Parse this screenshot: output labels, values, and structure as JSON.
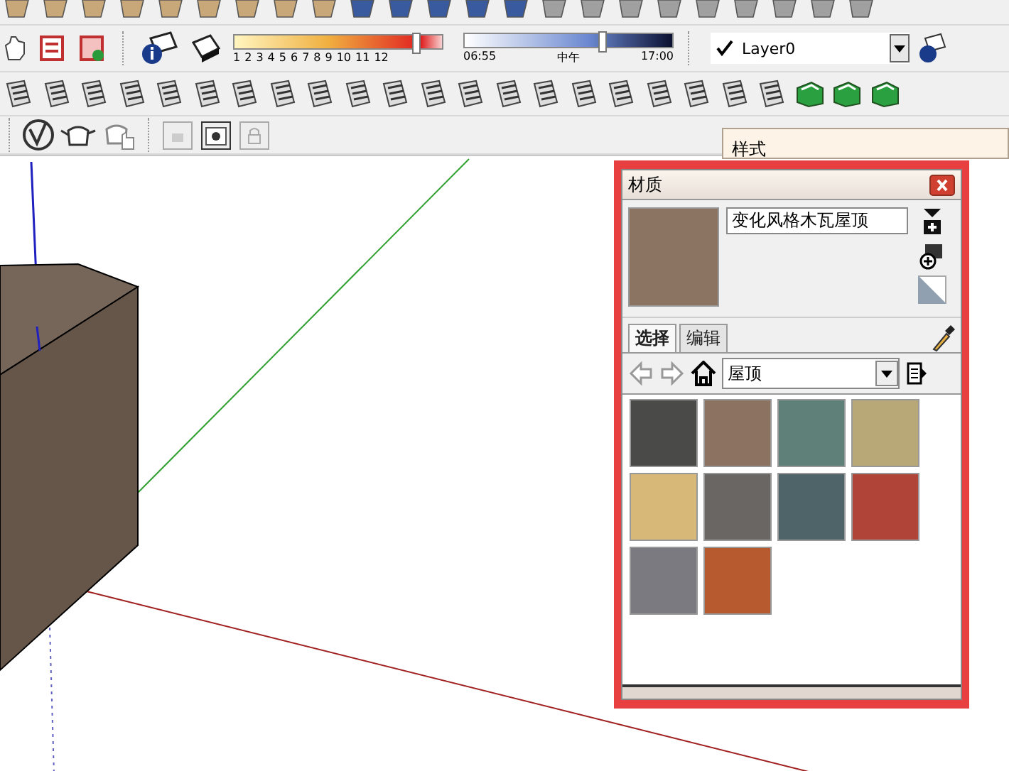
{
  "shadow_date": {
    "labels": [
      "1",
      "2",
      "3",
      "4",
      "5",
      "6",
      "7",
      "8",
      "9",
      "10",
      "11",
      "12"
    ],
    "level": 0.87
  },
  "shadow_time": {
    "start": "06:55",
    "middle": "中午",
    "end": "17:00",
    "level": 0.66
  },
  "layer": {
    "name": "Layer0",
    "checked": true
  },
  "styles_panel": {
    "title": "样式"
  },
  "materials_panel": {
    "title": "材质",
    "material_name": "变化风格木瓦屋顶",
    "tabs": [
      {
        "label": "选择",
        "selected": true
      },
      {
        "label": "编辑",
        "selected": false
      }
    ],
    "collection": "屋顶",
    "swatches": [
      {
        "color": "#4a4a48"
      },
      {
        "color": "#8c7260"
      },
      {
        "color": "#5f8078"
      },
      {
        "color": "#b8a878"
      },
      {
        "color": "#d8b878"
      },
      {
        "color": "#6a6664"
      },
      {
        "color": "#4e6468"
      },
      {
        "color": "#b04438"
      },
      {
        "color": "#7a7a80"
      },
      {
        "color": "#b85a30"
      }
    ]
  }
}
